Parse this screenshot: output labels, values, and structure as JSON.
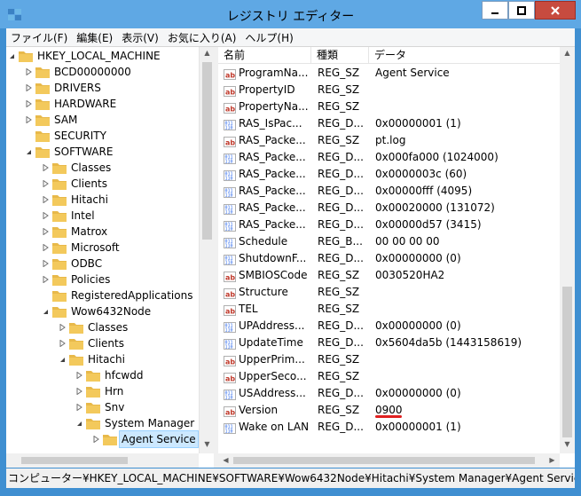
{
  "window": {
    "title": "レジストリ エディター"
  },
  "menu": [
    "ファイル(F)",
    "編集(E)",
    "表示(V)",
    "お気に入り(A)",
    "ヘルプ(H)"
  ],
  "tree": [
    {
      "label": "HKEY_LOCAL_MACHINE",
      "depth": 0,
      "expander": "open"
    },
    {
      "label": "BCD00000000",
      "depth": 1,
      "expander": "closed"
    },
    {
      "label": "DRIVERS",
      "depth": 1,
      "expander": "closed"
    },
    {
      "label": "HARDWARE",
      "depth": 1,
      "expander": "closed"
    },
    {
      "label": "SAM",
      "depth": 1,
      "expander": "closed"
    },
    {
      "label": "SECURITY",
      "depth": 1,
      "expander": "none"
    },
    {
      "label": "SOFTWARE",
      "depth": 1,
      "expander": "open"
    },
    {
      "label": "Classes",
      "depth": 2,
      "expander": "closed"
    },
    {
      "label": "Clients",
      "depth": 2,
      "expander": "closed"
    },
    {
      "label": "Hitachi",
      "depth": 2,
      "expander": "closed"
    },
    {
      "label": "Intel",
      "depth": 2,
      "expander": "closed"
    },
    {
      "label": "Matrox",
      "depth": 2,
      "expander": "closed"
    },
    {
      "label": "Microsoft",
      "depth": 2,
      "expander": "closed"
    },
    {
      "label": "ODBC",
      "depth": 2,
      "expander": "closed"
    },
    {
      "label": "Policies",
      "depth": 2,
      "expander": "closed"
    },
    {
      "label": "RegisteredApplications",
      "depth": 2,
      "expander": "none"
    },
    {
      "label": "Wow6432Node",
      "depth": 2,
      "expander": "open"
    },
    {
      "label": "Classes",
      "depth": 3,
      "expander": "closed"
    },
    {
      "label": "Clients",
      "depth": 3,
      "expander": "closed"
    },
    {
      "label": "Hitachi",
      "depth": 3,
      "expander": "open"
    },
    {
      "label": "hfcwdd",
      "depth": 4,
      "expander": "closed"
    },
    {
      "label": "Hrn",
      "depth": 4,
      "expander": "closed"
    },
    {
      "label": "Snv",
      "depth": 4,
      "expander": "closed"
    },
    {
      "label": "System Manager",
      "depth": 4,
      "expander": "open"
    },
    {
      "label": "Agent Service",
      "depth": 5,
      "expander": "closed",
      "selected": true
    }
  ],
  "list": {
    "columns": [
      "名前",
      "種類",
      "データ"
    ],
    "rows": [
      {
        "icon": "string",
        "name": "ProgramNa...",
        "type": "REG_SZ",
        "data": "Agent Service"
      },
      {
        "icon": "string",
        "name": "PropertyID",
        "type": "REG_SZ",
        "data": ""
      },
      {
        "icon": "string",
        "name": "PropertyNa...",
        "type": "REG_SZ",
        "data": ""
      },
      {
        "icon": "binary",
        "name": "RAS_IsPac...",
        "type": "REG_D...",
        "data": "0x00000001 (1)"
      },
      {
        "icon": "string",
        "name": "RAS_Packe...",
        "type": "REG_SZ",
        "data": "pt.log"
      },
      {
        "icon": "binary",
        "name": "RAS_Packe...",
        "type": "REG_D...",
        "data": "0x000fa000 (1024000)"
      },
      {
        "icon": "binary",
        "name": "RAS_Packe...",
        "type": "REG_D...",
        "data": "0x0000003c (60)"
      },
      {
        "icon": "binary",
        "name": "RAS_Packe...",
        "type": "REG_D...",
        "data": "0x00000fff (4095)"
      },
      {
        "icon": "binary",
        "name": "RAS_Packe...",
        "type": "REG_D...",
        "data": "0x00020000 (131072)"
      },
      {
        "icon": "binary",
        "name": "RAS_Packe...",
        "type": "REG_D...",
        "data": "0x00000d57 (3415)"
      },
      {
        "icon": "binary",
        "name": "Schedule",
        "type": "REG_B...",
        "data": "00 00 00 00"
      },
      {
        "icon": "binary",
        "name": "ShutdownF...",
        "type": "REG_D...",
        "data": "0x00000000 (0)"
      },
      {
        "icon": "string",
        "name": "SMBIOSCode",
        "type": "REG_SZ",
        "data": "0030520HA2"
      },
      {
        "icon": "string",
        "name": "Structure",
        "type": "REG_SZ",
        "data": ""
      },
      {
        "icon": "string",
        "name": "TEL",
        "type": "REG_SZ",
        "data": ""
      },
      {
        "icon": "binary",
        "name": "UPAddress...",
        "type": "REG_D...",
        "data": "0x00000000 (0)"
      },
      {
        "icon": "binary",
        "name": "UpdateTime",
        "type": "REG_D...",
        "data": "0x5604da5b (1443158619)"
      },
      {
        "icon": "string",
        "name": "UpperPrim...",
        "type": "REG_SZ",
        "data": ""
      },
      {
        "icon": "string",
        "name": "UpperSeco...",
        "type": "REG_SZ",
        "data": ""
      },
      {
        "icon": "binary",
        "name": "USAddress...",
        "type": "REG_D...",
        "data": "0x00000000 (0)"
      },
      {
        "icon": "string",
        "name": "Version",
        "type": "REG_SZ",
        "data": "0900"
      },
      {
        "icon": "binary",
        "name": "Wake on LAN",
        "type": "REG_D...",
        "data": "0x00000001 (1)"
      }
    ]
  },
  "status": {
    "path": "コンピューター¥HKEY_LOCAL_MACHINE¥SOFTWARE¥Wow6432Node¥Hitachi¥System Manager¥Agent Service"
  },
  "colors": {
    "titlebar": "#5fa8e4",
    "folder": "#e8b94a",
    "selection": "#cce8ff",
    "annotation": "#e02020"
  }
}
